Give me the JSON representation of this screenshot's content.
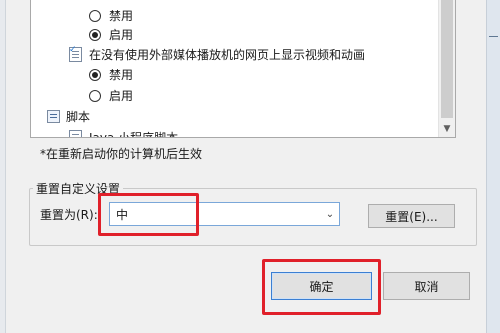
{
  "list": {
    "items": [
      {
        "type": "radio",
        "label": "禁用",
        "checked": false
      },
      {
        "type": "radio",
        "label": "启用",
        "checked": true
      },
      {
        "type": "setting",
        "label": "在没有使用外部媒体播放机的网页上显示视频和动画",
        "icon": "setting-doc-icon"
      },
      {
        "type": "radio",
        "label": "禁用",
        "checked": true
      },
      {
        "type": "radio",
        "label": "启用",
        "checked": false
      },
      {
        "type": "category",
        "label": "脚本",
        "icon": "script-icon"
      },
      {
        "type": "setting",
        "label": "Java 小程序脚本",
        "icon": "setting-doc-icon"
      }
    ]
  },
  "note": "*在重新启动你的计算机后生效",
  "reset_group": {
    "title": "重置自定义设置",
    "label": "重置为(R):",
    "selected": "中",
    "reset_button": "重置(E)..."
  },
  "buttons": {
    "ok": "确定",
    "cancel": "取消"
  },
  "colors": {
    "highlight": "#e0202a",
    "focus_border": "#3c7fd2"
  }
}
